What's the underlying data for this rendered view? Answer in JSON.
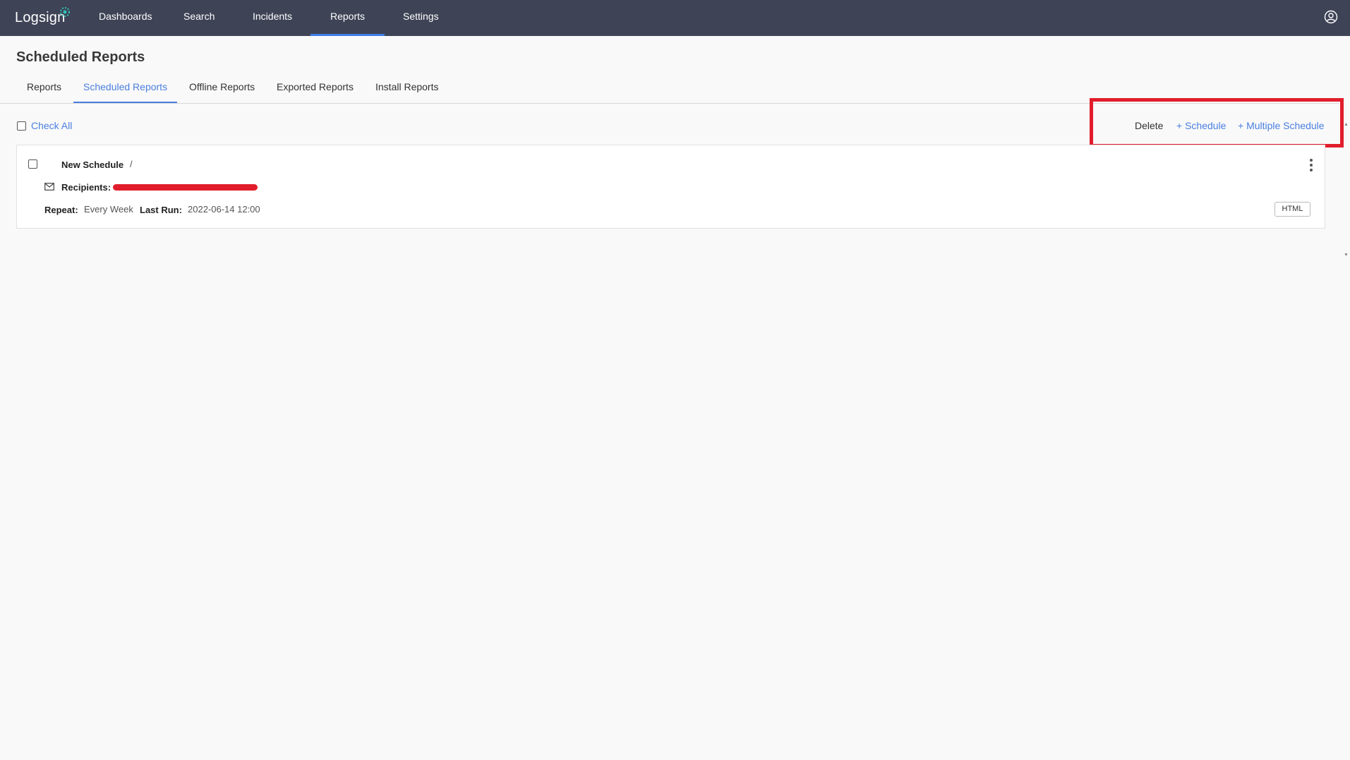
{
  "brand": {
    "name": "Logsign",
    "accent": "#3d7de8",
    "nav_bg": "#3e4356"
  },
  "topnav": {
    "items": [
      {
        "label": "Dashboards"
      },
      {
        "label": "Search"
      },
      {
        "label": "Incidents"
      },
      {
        "label": "Reports",
        "active": true
      },
      {
        "label": "Settings"
      }
    ],
    "user_icon": "user-circle-icon"
  },
  "page": {
    "title": "Scheduled Reports"
  },
  "tabs": [
    {
      "label": "Reports"
    },
    {
      "label": "Scheduled Reports",
      "active": true
    },
    {
      "label": "Offline Reports"
    },
    {
      "label": "Exported Reports"
    },
    {
      "label": "Install Reports"
    }
  ],
  "toolbar": {
    "check_all": "Check All",
    "delete": "Delete",
    "schedule": "+ Schedule",
    "multiple_schedule": "+ Multiple Schedule"
  },
  "schedules": [
    {
      "name": "New Schedule",
      "separator": "/",
      "recipients_label": "Recipients:",
      "recipients_value": "[redacted]",
      "repeat_label": "Repeat:",
      "repeat_value": "Every Week",
      "last_run_label": "Last Run:",
      "last_run_value": "2022-06-14 12:00",
      "format": "HTML"
    }
  ],
  "annotation": {
    "highlight_color": "#e11d2b"
  }
}
